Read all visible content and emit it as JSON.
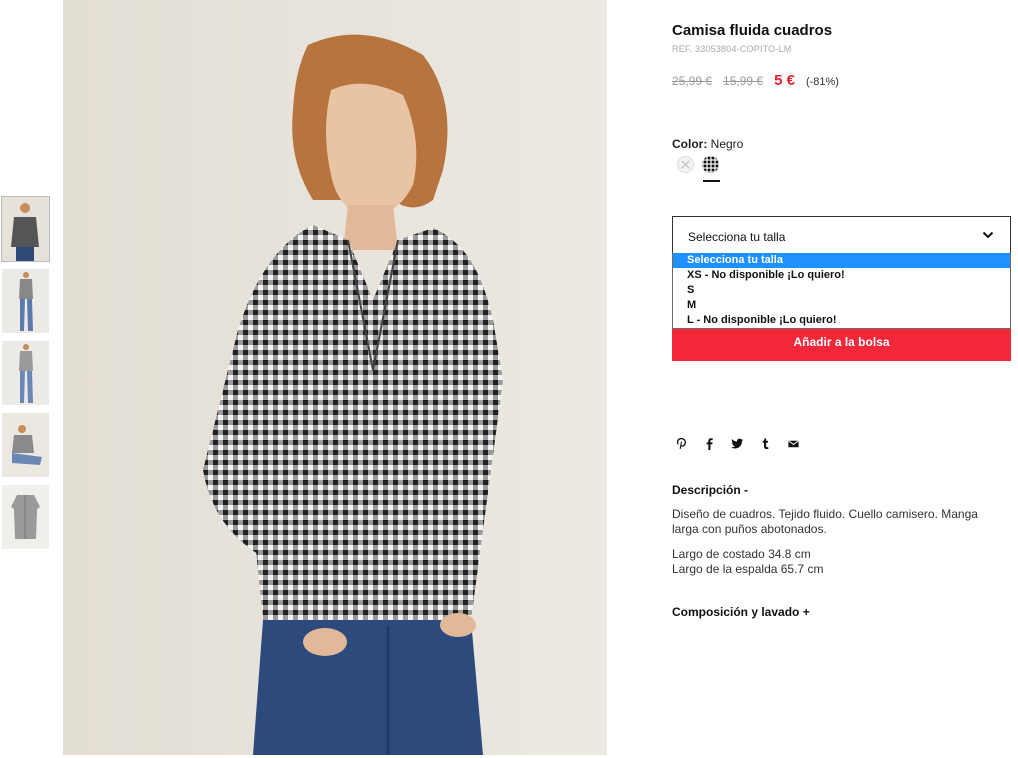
{
  "product": {
    "title": "Camisa fluida cuadros",
    "ref": "REF. 33053804-COPITO-LM",
    "original_price": "25,99 €",
    "previous_price": "15,99 €",
    "sale_price": "5 €",
    "discount": "(-81%)"
  },
  "color": {
    "label": "Color:",
    "value": "Negro",
    "swatches": [
      "white-check-swatch",
      "black-check-swatch"
    ],
    "selected": "black-check-swatch"
  },
  "size": {
    "placeholder": "Selecciona tu talla",
    "options": [
      "Selecciona tu talla",
      "XS - No disponible ¡Lo quiero!",
      "S",
      "M",
      "L - No disponible ¡Lo quiero!"
    ],
    "highlighted_index": 0
  },
  "actions": {
    "add_to_bag": "Añadir a la bolsa"
  },
  "share": {
    "icons": [
      "pinterest-icon",
      "facebook-icon",
      "twitter-icon",
      "tumblr-icon",
      "email-icon"
    ]
  },
  "description": {
    "heading": "Descripción -",
    "paragraph": "Diseño de cuadros. Tejido fluido. Cuello camisero. Manga larga con puños abotonados.",
    "side_length": "Largo de costado 34.8 cm",
    "back_length": "Largo de la espalda 65.7 cm"
  },
  "composition": {
    "heading": "Composición y lavado +"
  },
  "colors": {
    "sale": "#e6202e",
    "button": "#f2273a",
    "highlight": "#1e90ff"
  }
}
